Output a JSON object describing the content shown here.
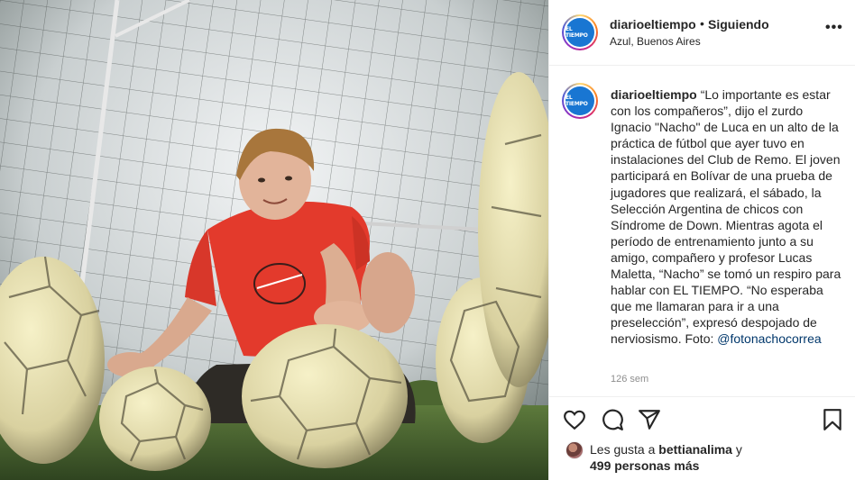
{
  "post": {
    "account": "diarioeltiempo",
    "avatar_text": "EL TIEMPO",
    "follow_status": "Siguiendo",
    "separator": "•",
    "location": "Azul, Buenos Aires",
    "more_icon": "more-horizontal-icon",
    "caption_username": "diarioeltiempo",
    "caption_text": "“Lo importante es estar con los compañeros”, dijo el zurdo Ignacio \"Nacho\" de Luca en un alto de la práctica de fútbol que ayer tuvo en instalaciones del Club de Remo. El joven participará en Bolívar de una prueba de jugadores que realizará, el sábado, la Selección Argentina de chicos con Síndrome de Down. Mientras agota el período de entrenamiento junto a su amigo, compañero y profesor Lucas Maletta, “Nacho” se tomó un respiro para hablar con EL TIEMPO. “No esperaba que me llamaran para ir a una preselección”, expresó despojado de nerviosismo. Foto:",
    "caption_mention": "@fotonachocorrea",
    "timestamp": "126 sem"
  },
  "actions": {
    "like_icon": "heart-icon",
    "comment_icon": "comment-icon",
    "share_icon": "share-icon",
    "save_icon": "bookmark-icon"
  },
  "likes": {
    "prefix": "Les gusta a",
    "liker": "bettianalima",
    "conjunction": "y",
    "others": "499 personas más"
  },
  "colors": {
    "accent_blue": "#0095f6",
    "mention": "#00376b",
    "muted": "#8e8e8e",
    "jersey": "#e33a2c",
    "logo_blue": "#1976d2"
  }
}
